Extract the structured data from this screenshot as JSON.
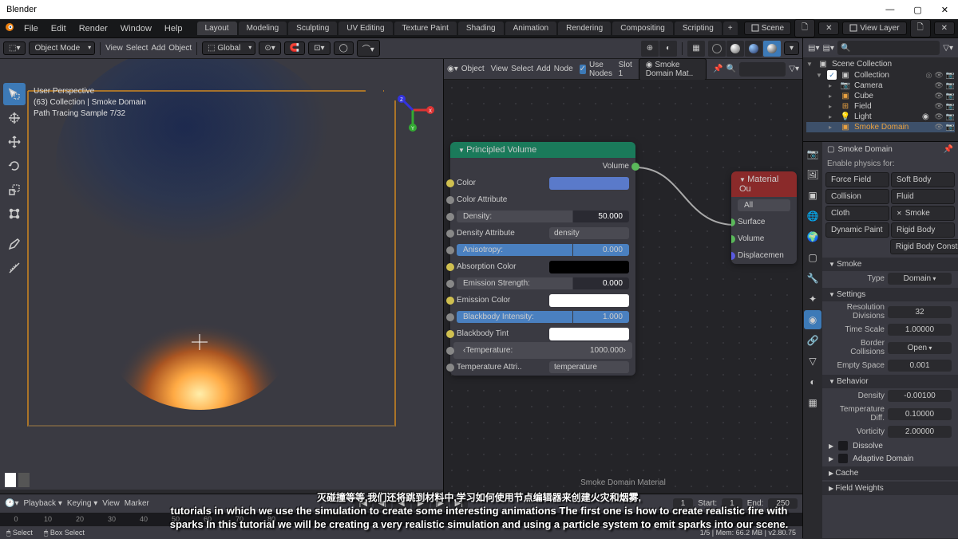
{
  "window": {
    "title": "Blender"
  },
  "topmenu": {
    "items": [
      "File",
      "Edit",
      "Render",
      "Window",
      "Help"
    ],
    "tabs": [
      "Layout",
      "Modeling",
      "Sculpting",
      "UV Editing",
      "Texture Paint",
      "Shading",
      "Animation",
      "Rendering",
      "Compositing",
      "Scripting"
    ],
    "active_tab": 0,
    "scene": "Scene",
    "view_layer": "View Layer"
  },
  "vp": {
    "mode": "Object Mode",
    "menus": [
      "View",
      "Select",
      "Add",
      "Object"
    ],
    "orient": "Global",
    "overlay_persp": "User Perspective",
    "overlay_obj": "(63) Collection | Smoke Domain",
    "overlay_sample": "Path Tracing Sample 7/32"
  },
  "node_hdr": {
    "label_btn": "Object",
    "menus": [
      "View",
      "Select",
      "Add",
      "Node"
    ],
    "usenodes": "Use Nodes",
    "slot": "Slot 1",
    "mat": "Smoke Domain Mat.."
  },
  "principled": {
    "title": "Principled Volume",
    "out": "Volume",
    "rows": {
      "color": "Color",
      "color_attr": "Color Attribute",
      "density": "Density:",
      "density_val": "50.000",
      "density_attr": "Density Attribute",
      "density_attr_val": "density",
      "aniso": "Anisotropy:",
      "aniso_val": "0.000",
      "absorp": "Absorption Color",
      "emit_str": "Emission Strength:",
      "emit_str_val": "0.000",
      "emit_col": "Emission Color",
      "bb_int": "Blackbody Intensity:",
      "bb_int_val": "1.000",
      "bb_tint": "Blackbody Tint",
      "temp": "Temperature:",
      "temp_val": "1000.000",
      "temp_attr": "Temperature Attri..",
      "temp_attr_val": "temperature"
    }
  },
  "matout": {
    "title": "Material Ou",
    "all": "All",
    "surface": "Surface",
    "volume": "Volume",
    "disp": "Displacemen"
  },
  "node_bottom": "Smoke Domain Material",
  "timeline": {
    "menus": [
      "Playback",
      "Keying",
      "View",
      "Marker"
    ],
    "start_lbl": "Start:",
    "start": "1",
    "end_lbl": "End:",
    "end": "250",
    "ticks": [
      "0",
      "10",
      "20",
      "30",
      "40",
      "50",
      "60",
      "70",
      "80"
    ]
  },
  "status": {
    "select": "Select",
    "box": "Box Select",
    "right": "1/5 | Mem: 66.2 MB | v2.80.75"
  },
  "outliner": {
    "root": "Scene Collection",
    "coll": "Collection",
    "items": [
      "Camera",
      "Cube",
      "Field",
      "Light",
      "Smoke Domain"
    ]
  },
  "props": {
    "breadcrumb": "Smoke Domain",
    "enable_physics": "Enable physics for:",
    "force": "Force Field",
    "soft": "Soft Body",
    "collision": "Collision",
    "fluid": "Fluid",
    "cloth": "Cloth",
    "smoke": "Smoke",
    "dynpaint": "Dynamic Paint",
    "rigid": "Rigid Body",
    "rbc": "Rigid Body Constra..",
    "smoke_panel": "Smoke",
    "type_lbl": "Type",
    "type_val": "Domain",
    "settings": "Settings",
    "res_lbl": "Resolution Divisions",
    "res_val": "32",
    "time_lbl": "Time Scale",
    "time_val": "1.00000",
    "border_lbl": "Border Collisions",
    "border_val": "Open",
    "empty_lbl": "Empty Space",
    "empty_val": "0.001",
    "behavior": "Behavior",
    "dens_lbl": "Density",
    "dens_val": "-0.00100",
    "tdiff_lbl": "Temperature Diff.",
    "tdiff_val": "0.10000",
    "vort_lbl": "Vorticity",
    "vort_val": "2.00000",
    "dissolve": "Dissolve",
    "adaptive": "Adaptive Domain",
    "cache": "Cache",
    "field_weights": "Field Weights"
  },
  "subs": {
    "cn": "灭碰撞等等,我们还将跳到材料中,学习如何使用节点编辑器来创建火灾和烟雾,",
    "en1": "tutorials in which we use the simulation to create some interesting animations  The first one is how to create realistic fire with",
    "en2": "sparks  In this tutorial  we will be creating a very realistic simulation and using a particle system to emit sparks into our scene."
  }
}
